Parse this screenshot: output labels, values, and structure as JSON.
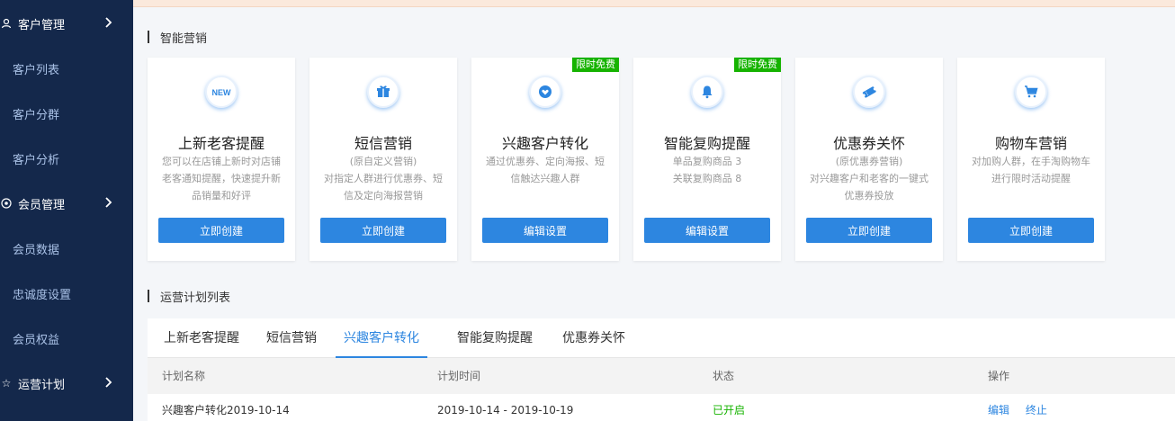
{
  "sidebar": {
    "groups": [
      {
        "label": "客户管理",
        "items": [
          "客户列表",
          "客户分群",
          "客户分析"
        ]
      },
      {
        "label": "会员管理",
        "items": [
          "会员数据",
          "忠诚度设置",
          "会员权益"
        ]
      },
      {
        "label": "运营计划",
        "items": []
      }
    ]
  },
  "marketing": {
    "title": "智能营销",
    "cards": [
      {
        "name": "上新老客提醒",
        "icon": "new-badge-icon",
        "desc": "您可以在店铺上新时对店铺老客通知提醒，快速提升新品销量和好评",
        "button": "立即创建",
        "badge": ""
      },
      {
        "name": "短信营销",
        "icon": "gift-icon",
        "desc": "(原自定义营销)\n对指定人群进行优惠券、短信及定向海报营销",
        "button": "立即创建",
        "badge": ""
      },
      {
        "name": "兴趣客户转化",
        "icon": "heart-icon",
        "desc": "通过优惠券、定向海报、短信触达兴趣人群",
        "button": "编辑设置",
        "badge": "限时免费"
      },
      {
        "name": "智能复购提醒",
        "icon": "bell-icon",
        "desc": "单品复购商品 3\n关联复购商品 8",
        "button": "编辑设置",
        "badge": "限时免费"
      },
      {
        "name": "优惠券关怀",
        "icon": "ticket-icon",
        "desc": "(原优惠券营销)\n对兴趣客户和老客的一键式优惠券投放",
        "button": "立即创建",
        "badge": ""
      },
      {
        "name": "购物车营销",
        "icon": "cart-icon",
        "desc": "对加购人群，在手淘购物车进行限时活动提醒",
        "button": "立即创建",
        "badge": ""
      }
    ]
  },
  "plans": {
    "title": "运营计划列表",
    "tabs": [
      "上新老客提醒",
      "短信营销",
      "兴趣客户转化",
      "智能复购提醒",
      "优惠券关怀"
    ],
    "active_tab": 2,
    "columns": [
      "计划名称",
      "计划时间",
      "状态",
      "操作"
    ],
    "rows": [
      {
        "name": "兴趣客户转化2019-10-14",
        "time": "2019-10-14 - 2019-10-19",
        "status": "已开启",
        "actions": [
          "编辑",
          "终止"
        ]
      }
    ]
  },
  "colors": {
    "accent": "#2d86e0",
    "sidebar": "#14284b",
    "badge": "#16b300"
  }
}
